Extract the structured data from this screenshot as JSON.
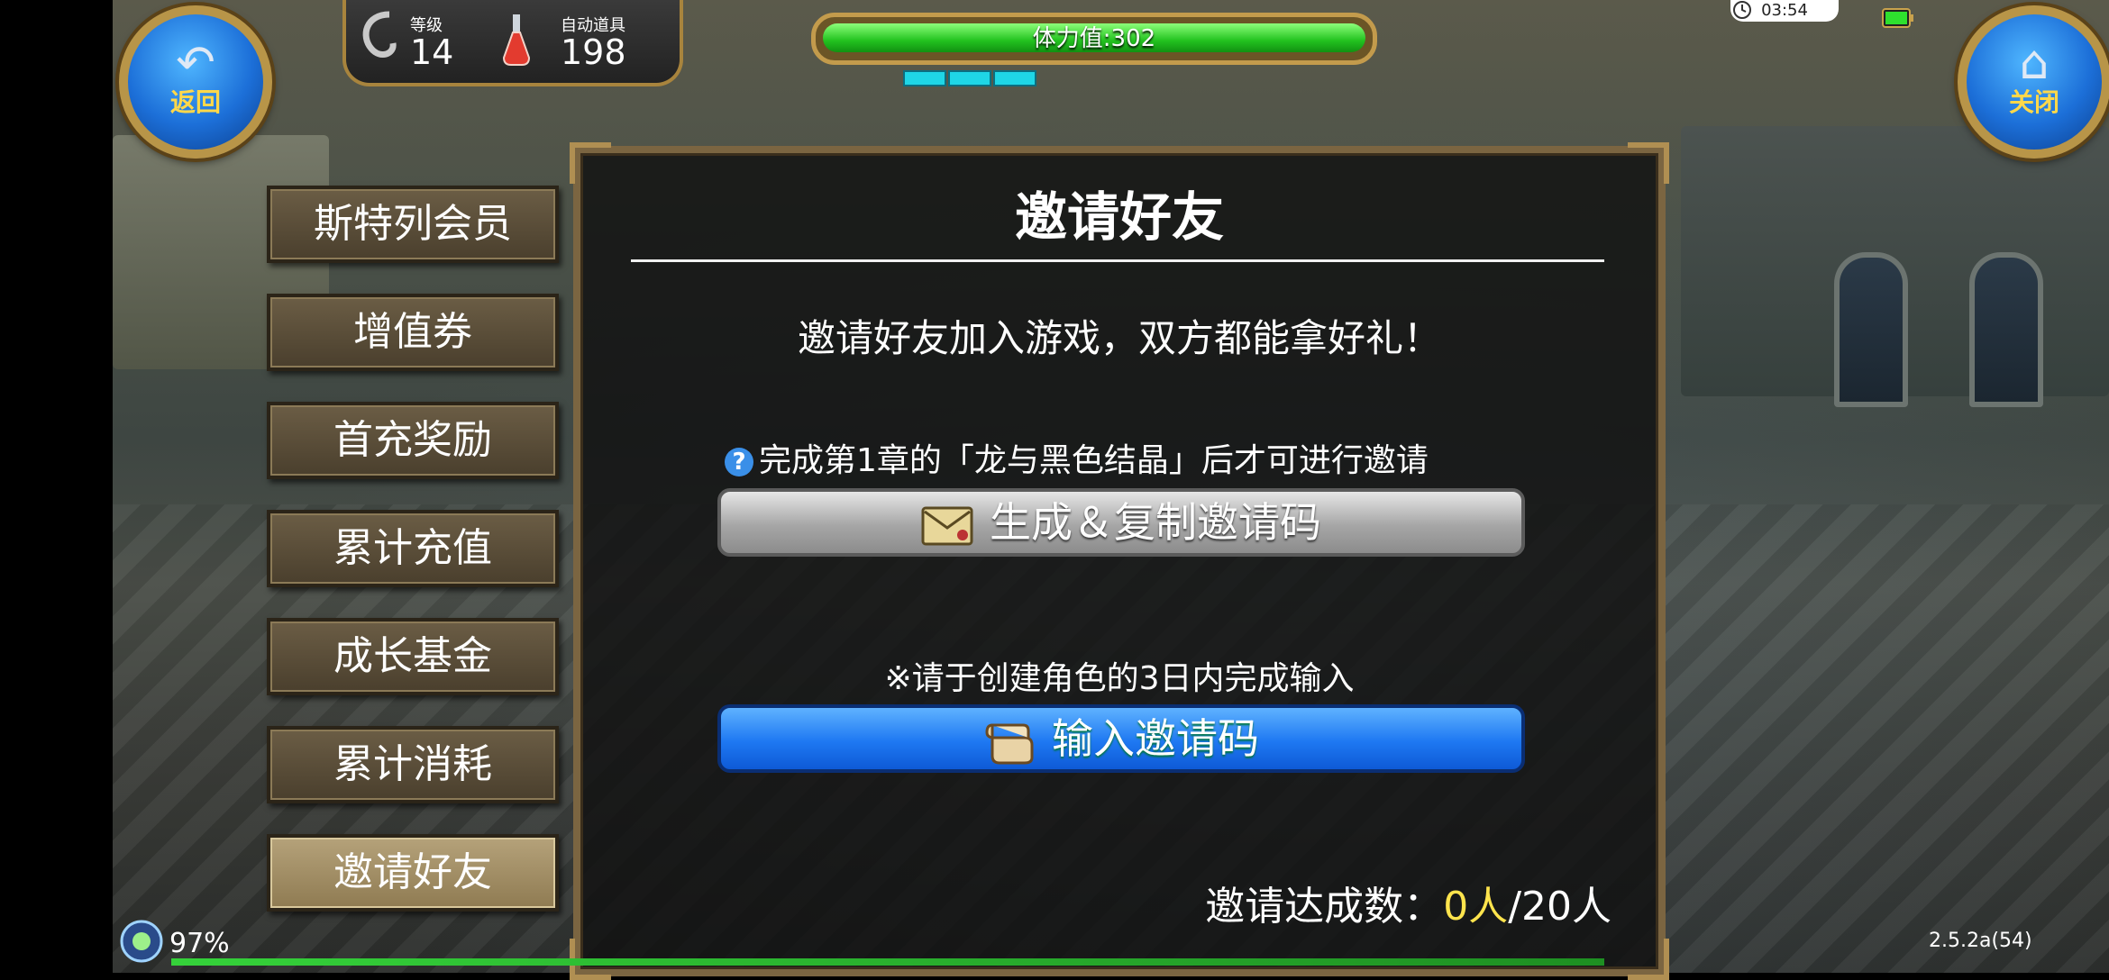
{
  "top_bar": {
    "back_label": "返回",
    "close_label": "关闭",
    "level_caption": "等级",
    "level_value": "14",
    "auto_item_caption": "自动道具",
    "auto_item_value": "198",
    "stamina_text": "体力值:302",
    "stamina_level": 1.0,
    "clock": "03:54",
    "colors": {
      "stamina": "#22c21f",
      "frame_gold": "#c39b4c",
      "button_blue": "#1c6fd8"
    }
  },
  "side_menu": {
    "items": [
      {
        "label": "斯特列会员",
        "active": false
      },
      {
        "label": "增值券",
        "active": false
      },
      {
        "label": "首充奖励",
        "active": false
      },
      {
        "label": "累计充值",
        "active": false
      },
      {
        "label": "成长基金",
        "active": false
      },
      {
        "label": "累计消耗",
        "active": false
      },
      {
        "label": "邀请好友",
        "active": true
      }
    ]
  },
  "dialog": {
    "title": "邀请好友",
    "subtitle": "邀请好友加入游戏，双方都能拿好礼！",
    "requirement_note": "完成第1章的「龙与黑色结晶」后才可进行邀请",
    "generate_button": "生成＆复制邀请码",
    "deadline_note": "※请于创建角色的3日内完成输入",
    "input_button": "输入邀请码",
    "invite_count_label": "邀请达成数：",
    "invite_current": "0人",
    "invite_total": "/20人",
    "colors": {
      "highlight": "#ffe44d",
      "input_button": "#1e78f2",
      "generate_button": "#a6a6a6"
    }
  },
  "status": {
    "battery_percent": "97%",
    "version": "2.5.2a(54)"
  },
  "icons": [
    "back-arrow-icon",
    "home-icon",
    "potion-icon",
    "help-icon",
    "letter-icon",
    "scroll-icon",
    "signal-icon",
    "clock-icon",
    "battery-icon"
  ]
}
